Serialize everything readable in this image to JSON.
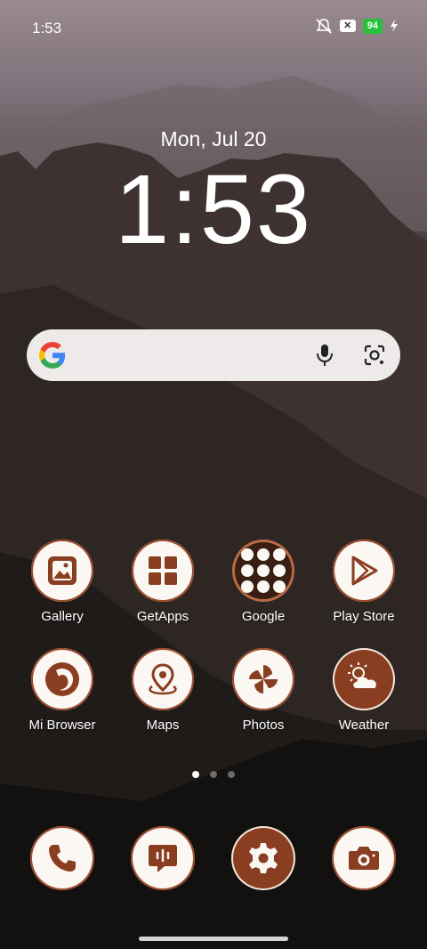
{
  "status_bar": {
    "time": "1:53",
    "battery": "94"
  },
  "lockclock": {
    "date": "Mon, Jul 20",
    "time": "1:53"
  },
  "search": {
    "icons": [
      "google-g-icon",
      "mic-icon",
      "lens-icon"
    ]
  },
  "apps_row1": [
    {
      "label": "Gallery",
      "icon": "gallery-icon"
    },
    {
      "label": "GetApps",
      "icon": "getapps-icon"
    },
    {
      "label": "Google",
      "icon": "folder-icon"
    },
    {
      "label": "Play Store",
      "icon": "play-store-icon"
    }
  ],
  "apps_row2": [
    {
      "label": "Mi Browser",
      "icon": "mi-browser-icon"
    },
    {
      "label": "Maps",
      "icon": "maps-icon"
    },
    {
      "label": "Photos",
      "icon": "photos-icon"
    },
    {
      "label": "Weather",
      "icon": "weather-icon"
    }
  ],
  "dock": [
    {
      "icon": "phone-icon"
    },
    {
      "icon": "messages-icon"
    },
    {
      "icon": "settings-icon"
    },
    {
      "icon": "camera-icon"
    }
  ],
  "page_indicator": {
    "pages": 3,
    "current": 1
  },
  "theme": {
    "icon_fill": "#fbf7f3",
    "icon_accent": "#8a3e21"
  }
}
